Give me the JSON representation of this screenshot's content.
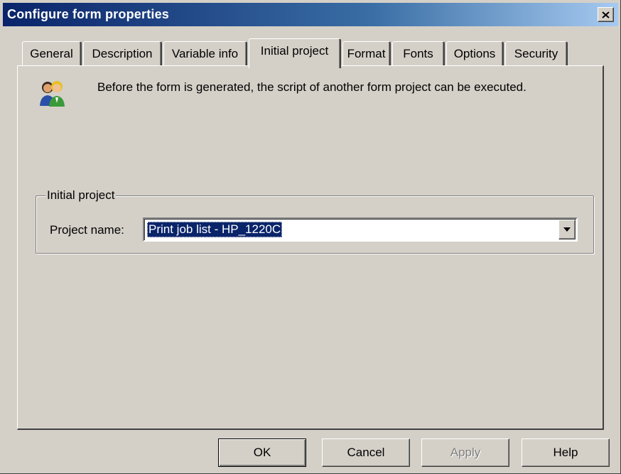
{
  "window": {
    "title": "Configure form properties",
    "close_glyph": "×"
  },
  "tabs": [
    {
      "label": "General",
      "active": false
    },
    {
      "label": "Description",
      "active": false
    },
    {
      "label": "Variable info",
      "active": false
    },
    {
      "label": "Initial project",
      "active": true
    },
    {
      "label": "Format",
      "active": false
    },
    {
      "label": "Fonts",
      "active": false
    },
    {
      "label": "Options",
      "active": false
    },
    {
      "label": "Security",
      "active": false
    }
  ],
  "panel": {
    "icon": "users-icon",
    "info_text": "Before the form is generated, the script of another form project can be executed.",
    "group": {
      "legend": "Initial project",
      "project_label": "Project name:",
      "project_value": "Print job list - HP_1220C"
    }
  },
  "buttons": {
    "ok": "OK",
    "cancel": "Cancel",
    "apply": "Apply",
    "help": "Help"
  },
  "colors": {
    "title_bar": "#0a246a",
    "dialog_face": "#d4d0c8",
    "selection": "#0a246a"
  }
}
